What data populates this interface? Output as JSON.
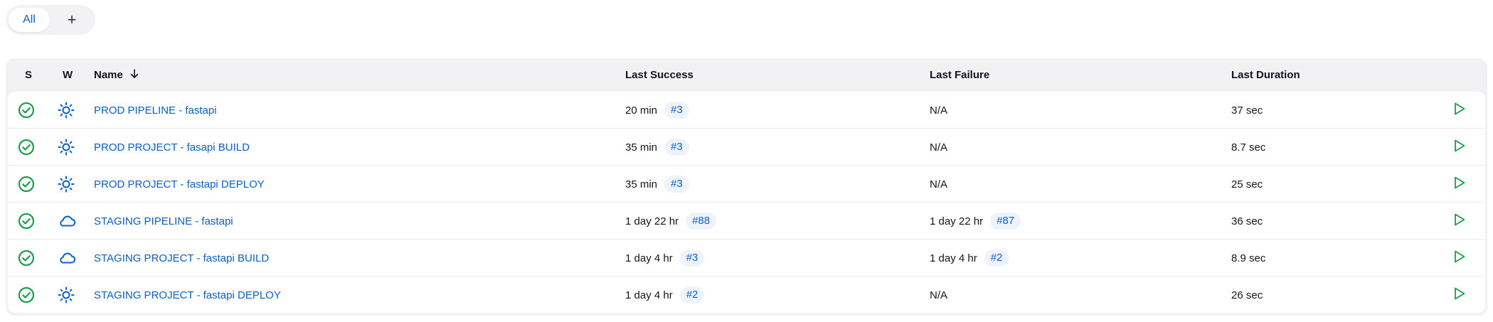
{
  "tabs": {
    "all_label": "All",
    "add_label": "+"
  },
  "table": {
    "headers": {
      "status": "S",
      "weather": "W",
      "name": "Name",
      "last_success": "Last Success",
      "last_failure": "Last Failure",
      "last_duration": "Last Duration"
    },
    "rows": [
      {
        "name": "PROD PIPELINE - fastapi",
        "weather": "sunny-icon",
        "success_time": "20 min",
        "success_build": "#3",
        "failure_time": "N/A",
        "failure_build": "",
        "duration": "37 sec"
      },
      {
        "name": "PROD PROJECT - fasapi BUILD",
        "weather": "sunny-icon",
        "success_time": "35 min",
        "success_build": "#3",
        "failure_time": "N/A",
        "failure_build": "",
        "duration": "8.7 sec"
      },
      {
        "name": "PROD PROJECT - fastapi DEPLOY",
        "weather": "sunny-icon",
        "success_time": "35 min",
        "success_build": "#3",
        "failure_time": "N/A",
        "failure_build": "",
        "duration": "25 sec"
      },
      {
        "name": "STAGING PIPELINE - fastapi",
        "weather": "cloudy-icon",
        "success_time": "1 day 22 hr",
        "success_build": "#88",
        "failure_time": "1 day 22 hr",
        "failure_build": "#87",
        "duration": "36 sec"
      },
      {
        "name": "STAGING PROJECT - fastapi BUILD",
        "weather": "cloudy-icon",
        "success_time": "1 day 4 hr",
        "success_build": "#3",
        "failure_time": "1 day 4 hr",
        "failure_build": "#2",
        "duration": "8.9 sec"
      },
      {
        "name": "STAGING PROJECT - fastapi DEPLOY",
        "weather": "sunny-icon",
        "success_time": "1 day 4 hr",
        "success_build": "#2",
        "failure_time": "N/A",
        "failure_build": "",
        "duration": "26 sec"
      }
    ]
  },
  "colors": {
    "link": "#0b5fc7",
    "success": "#1a9e4a",
    "header_bg": "#f2f2f5"
  }
}
